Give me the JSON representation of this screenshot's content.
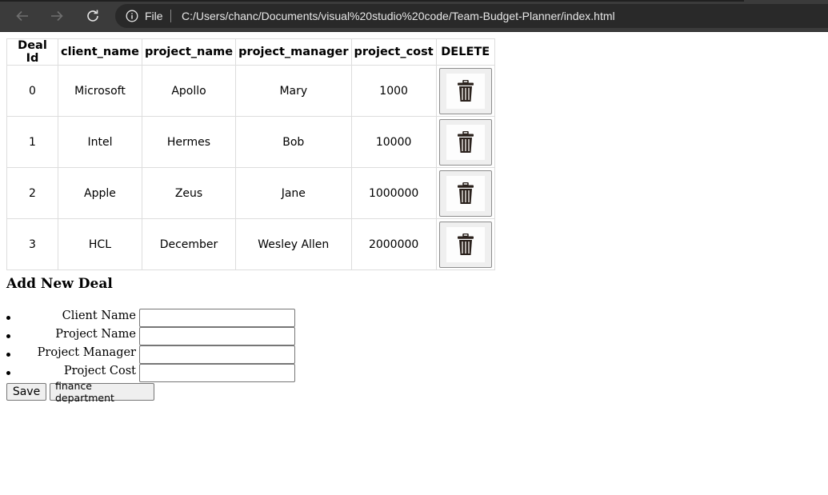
{
  "browser": {
    "scheme_label": "File",
    "url": "C:/Users/chanc/Documents/visual%20studio%20code/Team-Budget-Planner/index.html",
    "icons": [
      "back-arrow-icon",
      "forward-arrow-icon",
      "refresh-icon",
      "info-icon"
    ]
  },
  "table": {
    "headers": [
      "Deal Id",
      "client_name",
      "project_name",
      "project_manager",
      "project_cost",
      "DELETE"
    ],
    "rows": [
      {
        "id": "0",
        "client": "Microsoft",
        "project": "Apollo",
        "manager": "Mary",
        "cost": "1000"
      },
      {
        "id": "1",
        "client": "Intel",
        "project": "Hermes",
        "manager": "Bob",
        "cost": "10000"
      },
      {
        "id": "2",
        "client": "Apple",
        "project": "Zeus",
        "manager": "Jane",
        "cost": "1000000"
      },
      {
        "id": "3",
        "client": "HCL",
        "project": "December",
        "manager": "Wesley Allen",
        "cost": "2000000"
      }
    ],
    "delete_icon": "trash-icon"
  },
  "form": {
    "title": "Add New Deal",
    "fields": [
      {
        "label": "Client Name",
        "value": ""
      },
      {
        "label": "Project Name",
        "value": ""
      },
      {
        "label": "Project Manager",
        "value": ""
      },
      {
        "label": "Project Cost",
        "value": ""
      }
    ],
    "save_label": "Save",
    "finance_label": "finance department"
  }
}
